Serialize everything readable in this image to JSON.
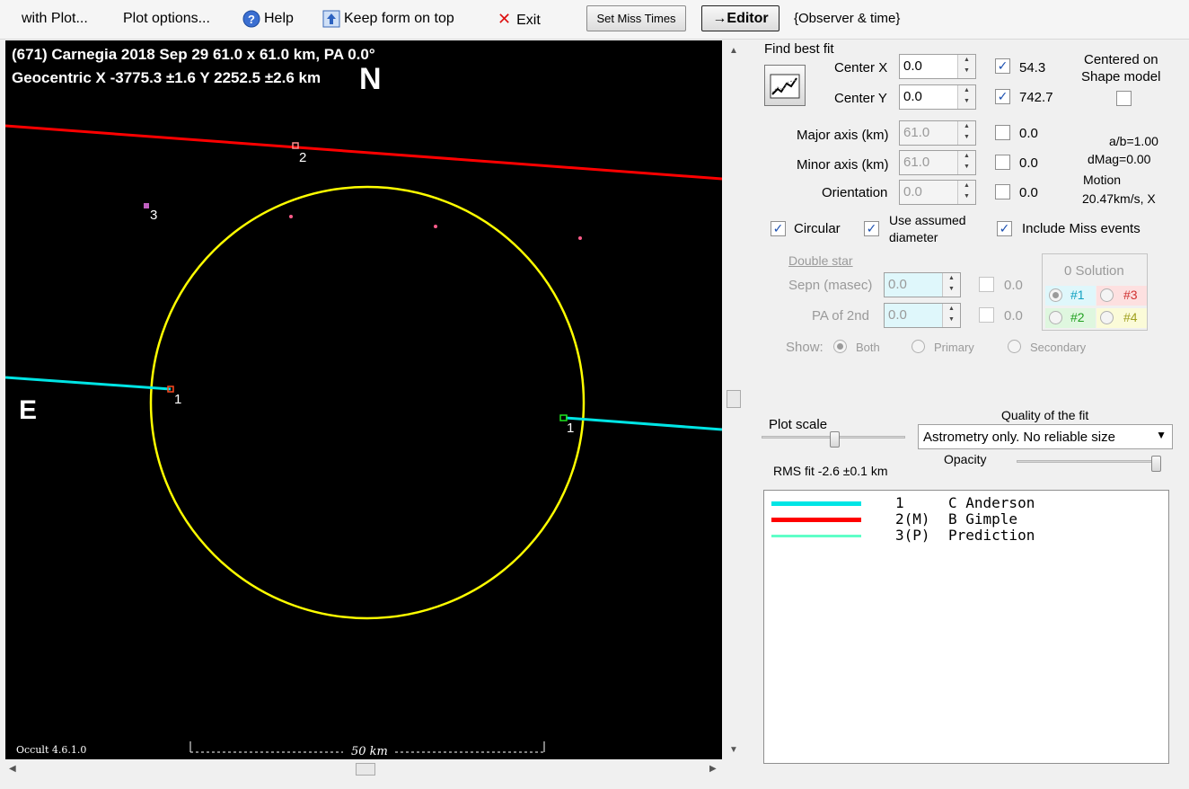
{
  "menu": {
    "with_plot": "with Plot...",
    "plot_options": "Plot options...",
    "help": "Help",
    "keep_on_top": "Keep form on top",
    "exit": "Exit",
    "set_miss_times": "Set Miss Times",
    "editor": "→Editor",
    "observer_time": "{Observer & time}"
  },
  "plot": {
    "header_line1": "(671) Carnegia  2018 Sep 29  61.0 x 61.0 km, PA 0.0°",
    "header_line2": "Geocentric  X  -3775.3 ±1.6   Y 2252.5 ±2.6 km",
    "north": "N",
    "east": "E",
    "version": "Occult 4.6.1.0",
    "scale": "50 km",
    "chord_labels": [
      "1",
      "1",
      "2",
      "3"
    ],
    "colors": {
      "ellipse": "#ffff00",
      "chord1": "#00e5e5",
      "chord2": "#ff0000",
      "prediction": "#5fffc8",
      "background": "#000000"
    }
  },
  "panel": {
    "find_best_fit": "Find best fit",
    "center_x": {
      "label": "Center X",
      "value": "0.0",
      "checked": "✓",
      "result": "54.3"
    },
    "center_y": {
      "label": "Center Y",
      "value": "0.0",
      "checked": "✓",
      "result": "742.7"
    },
    "centered_on": "Centered on",
    "shape_model": "Shape model",
    "major_axis": {
      "label": "Major axis (km)",
      "value": "61.0",
      "result": "0.0"
    },
    "minor_axis": {
      "label": "Minor axis (km)",
      "value": "61.0",
      "result": "0.0"
    },
    "orientation": {
      "label": "Orientation",
      "value": "0.0",
      "result": "0.0"
    },
    "ab": "a/b=1.00",
    "dmag": "dMag=0.00",
    "motion_label": "Motion",
    "motion_value": "20.47km/s, X",
    "circular": "Circular",
    "use_assumed_1": "Use assumed",
    "use_assumed_2": "diameter",
    "include_miss": "Include Miss events",
    "double_star": "Double star",
    "sepn": {
      "label": "Sepn (masec)",
      "value": "0.0",
      "result": "0.0"
    },
    "pa2nd": {
      "label": "PA of 2nd",
      "value": "0.0",
      "result": "0.0"
    },
    "show_label": "Show:",
    "show_both": "Both",
    "show_primary": "Primary",
    "show_secondary": "Secondary",
    "solution_title": "0 Solution",
    "sol1": "#1",
    "sol2": "#2",
    "sol3": "#3",
    "sol4": "#4",
    "plot_scale": "Plot scale",
    "quality_label": "Quality of the fit",
    "quality_value": "Astrometry only. No reliable size",
    "opacity": "Opacity",
    "rms": "RMS fit -2.6 ±0.1 km",
    "legend": [
      {
        "id": "1",
        "name": "C Anderson",
        "color": "#00e5e5"
      },
      {
        "id": "2(M)",
        "name": "B Gimple",
        "color": "#ff0000"
      },
      {
        "id": "3(P)",
        "name": "Prediction",
        "color": "#5fffc8"
      }
    ]
  }
}
